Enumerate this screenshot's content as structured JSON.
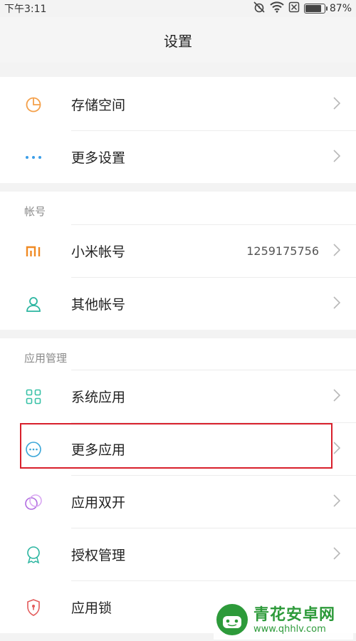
{
  "status_bar": {
    "time": "下午3:11",
    "battery_percent_text": "87%",
    "battery_level": 0.87
  },
  "header": {
    "title": "设置"
  },
  "rows": [
    {
      "label": "存储空间",
      "icon": "storage-pie-icon",
      "color": "#f4a04a"
    },
    {
      "label": "更多设置",
      "icon": "more-dots-icon",
      "color": "#3b9ee8"
    },
    {
      "label": "小米帐号",
      "icon": "mi-logo-icon",
      "color": "#f08a24",
      "value": "1259175756"
    },
    {
      "label": "其他帐号",
      "icon": "person-icon",
      "color": "#2bb5a0"
    },
    {
      "label": "系统应用",
      "icon": "grid-apps-icon",
      "color": "#38c1a7"
    },
    {
      "label": "更多应用",
      "icon": "more-circle-icon",
      "color": "#3aa6d8"
    },
    {
      "label": "应用双开",
      "icon": "dual-circles-icon",
      "color": "#b06be0"
    },
    {
      "label": "授权管理",
      "icon": "award-icon",
      "color": "#2bb5a0"
    },
    {
      "label": "应用锁",
      "icon": "shield-lock-icon",
      "color": "#e35a5a"
    }
  ],
  "sections": {
    "accounts": "帐号",
    "app_management": "应用管理"
  },
  "watermark": {
    "title": "青花安卓网",
    "url": "www.qhhlv.com"
  }
}
